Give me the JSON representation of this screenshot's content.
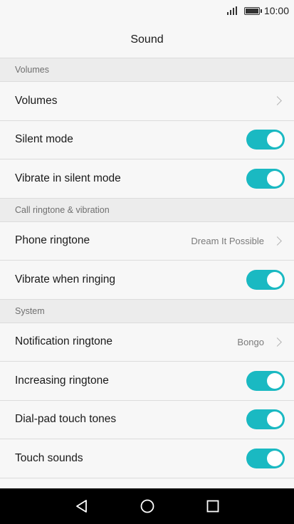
{
  "status_bar": {
    "time": "10:00",
    "signal_icon": "signal-icon",
    "battery_icon": "battery-icon"
  },
  "app_bar": {
    "title": "Sound"
  },
  "sections": [
    {
      "header": "Volumes",
      "rows": [
        {
          "label": "Volumes",
          "kind": "chevron",
          "value": ""
        },
        {
          "label": "Silent mode",
          "kind": "toggle",
          "on": true
        },
        {
          "label": "Vibrate in silent mode",
          "kind": "toggle",
          "on": true
        }
      ]
    },
    {
      "header": "Call ringtone & vibration",
      "rows": [
        {
          "label": "Phone ringtone",
          "kind": "chevron",
          "value": "Dream It Possible"
        },
        {
          "label": "Vibrate when ringing",
          "kind": "toggle",
          "on": true
        }
      ]
    },
    {
      "header": "System",
      "rows": [
        {
          "label": "Notification ringtone",
          "kind": "chevron",
          "value": "Bongo"
        },
        {
          "label": "Increasing ringtone",
          "kind": "toggle",
          "on": true
        },
        {
          "label": "Dial-pad touch tones",
          "kind": "toggle",
          "on": true
        },
        {
          "label": "Touch sounds",
          "kind": "toggle",
          "on": true
        }
      ]
    }
  ],
  "nav_bar": {
    "back_icon": "back-icon",
    "home_icon": "home-icon",
    "recents_icon": "recents-icon"
  },
  "colors": {
    "accent": "#1ab9c2",
    "background": "#f7f7f7",
    "section_bg": "#ececec"
  }
}
